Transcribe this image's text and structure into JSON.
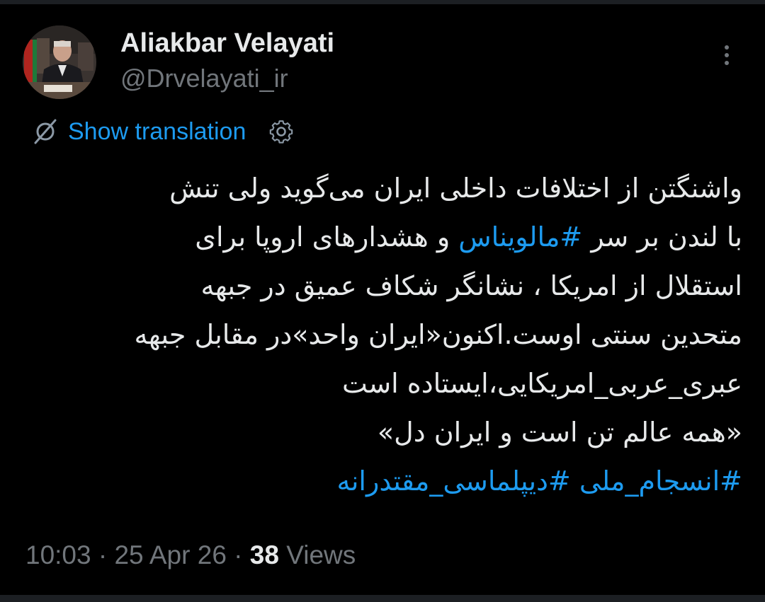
{
  "author": {
    "display_name": "Aliakbar Velayati",
    "handle": "@Drvelayati_ir"
  },
  "translation": {
    "label": "Show translation"
  },
  "tweet": {
    "line1": "واشنگتن از اختلافات داخلی ایران می‌گوید ولی تنش",
    "line2_before": "با لندن بر سر ",
    "line2_hashtag": "#مالویناس",
    "line2_after": " و هشدارهای اروپا برای",
    "line3": "استقلال از امریکا ، نشانگر شکاف عمیق در جبهه",
    "line4": "متحدین سنتی اوست.اکنون«ایران واحد»در مقابل جبهه",
    "line5": "عبری_عربی_امریکایی،ایستاده است",
    "line6": "«همه عالم تن است و ایران دل»",
    "hashtag1": "#انسجام_ملی",
    "hashtag2": "#دیپلماسی_مقتدرانه"
  },
  "meta": {
    "time": "10:03",
    "separator1": " · ",
    "date": "25 Apr 26",
    "separator2": " · ",
    "views_count": "38",
    "views_label": " Views"
  },
  "colors": {
    "background": "#000000",
    "text": "#e7e9ea",
    "muted": "#71767b",
    "link": "#1d9bf0"
  },
  "icons": {
    "more": "more-vertical-icon",
    "translate": "translate-off-icon",
    "settings": "gear-icon"
  }
}
